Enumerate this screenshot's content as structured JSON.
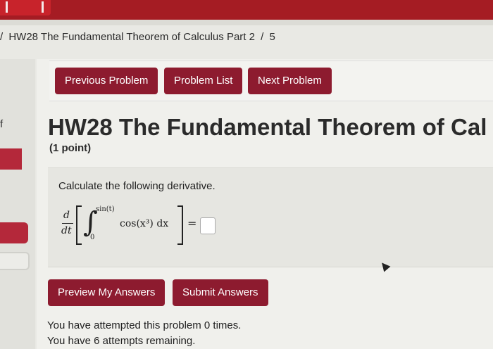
{
  "breadcrumb": {
    "separator1": "/",
    "title": "HW28 The Fundamental Theorem of Calculus Part 2",
    "separator2": "/",
    "number": "5"
  },
  "sidebar": {
    "letter": "f"
  },
  "nav": {
    "prev": "Previous Problem",
    "list": "Problem List",
    "next": "Next Problem"
  },
  "problem": {
    "title": "HW28 The Fundamental Theorem of Cal",
    "points": "(1 point)",
    "instruction": "Calculate the following derivative.",
    "math": {
      "d": "d",
      "dt": "dt",
      "integral": "∫",
      "upper": "sin(t)",
      "lower": "0",
      "integrand": "cos(x³) dx",
      "equals": "="
    },
    "answer_value": ""
  },
  "actions": {
    "preview": "Preview My Answers",
    "submit": "Submit Answers"
  },
  "status": {
    "attempted": "You have attempted this problem 0 times.",
    "remaining": "You have 6 attempts remaining."
  },
  "colors": {
    "brand_red": "#a51c23",
    "button": "#8d1b2f"
  }
}
